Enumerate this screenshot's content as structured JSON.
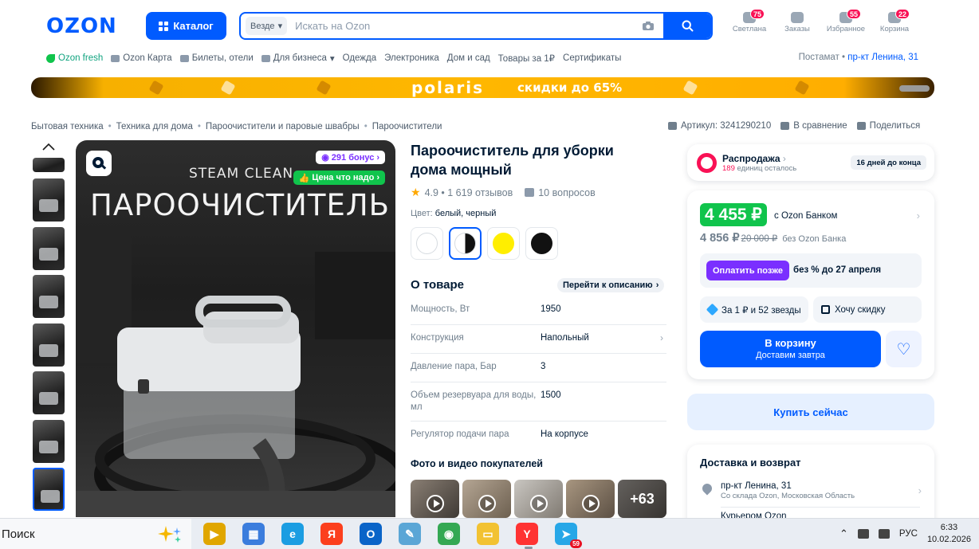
{
  "header": {
    "logo": "OZON",
    "catalog_label": "Каталог",
    "search": {
      "scope": "Везде",
      "placeholder": "Искать на Ozon"
    },
    "icons": [
      {
        "label": "Светлана",
        "badge": "75"
      },
      {
        "label": "Заказы",
        "badge": ""
      },
      {
        "label": "Избранное",
        "badge": "55"
      },
      {
        "label": "Корзина",
        "badge": "22"
      }
    ]
  },
  "nav": {
    "items": [
      "Ozon fresh",
      "Ozon Карта",
      "Билеты, отели",
      "Для бизнеса",
      "Одежда",
      "Электроника",
      "Дом и сад",
      "Товары за 1₽",
      "Сертификаты"
    ],
    "address_label": "Постамат",
    "address_value": "пр-кт Ленина, 31"
  },
  "banner": {
    "brand": "polaris",
    "promo": "скидки до 65%"
  },
  "breadcrumbs": [
    "Бытовая техника",
    "Техника для дома",
    "Пароочистители и паровые швабры",
    "Пароочистители"
  ],
  "meta": {
    "article": "Артикул: 3241290210",
    "compare": "В сравнение",
    "share": "Поделиться"
  },
  "photo": {
    "subtitle": "STEAM CLEAN",
    "headline": "ПАРООЧИСТИТЕЛЬ",
    "bonus": "291 бонус",
    "good_price": "Цена что надо"
  },
  "product": {
    "title": "Пароочиститель для уборки дома мощный",
    "rating": "4.9 • 1 619 отзывов",
    "questions": "10 вопросов",
    "color_label": "Цвет:",
    "color_value": "белый, черный",
    "swatches": [
      "#ffffff",
      "half",
      "#ffee00",
      "#111111"
    ],
    "about_title": "О товаре",
    "goto_desc": "Перейти к описанию",
    "specs": [
      {
        "k": "Мощность, Вт",
        "v": "1950"
      },
      {
        "k": "Конструкция",
        "v": "Напольный"
      },
      {
        "k": "Давление пара, Бар",
        "v": "3"
      },
      {
        "k": "Объем резервуара для воды, мл",
        "v": "1500"
      },
      {
        "k": "Регулятор подачи пара",
        "v": "На корпусе"
      }
    ],
    "buyer_media_title": "Фото и видео покупателей",
    "buyer_media_more": "+63"
  },
  "sale": {
    "title": "Распродажа",
    "left_count": "189",
    "left_label": "единиц осталось",
    "days": "16 дней до конца"
  },
  "price": {
    "main": "4 455 ₽",
    "main_note": "с Ozon Банком",
    "regular": "4 856 ₽",
    "old": "20 000 ₽",
    "regular_note": "без Ozon Банка",
    "paylater_btn": "Оплатить позже",
    "paylater_text": "без % до 27 апреля",
    "chip_stars": "За 1 ₽ и 52 звезды",
    "chip_discount": "Хочу скидку",
    "cart_label": "В корзину",
    "cart_sub": "Доставим завтра"
  },
  "buy_now": "Купить сейчас",
  "delivery": {
    "title": "Доставка и возврат",
    "address": "пр-кт Ленина, 31",
    "source": "Со склада Ozon, Московская Область",
    "courier": "Курьером Ozon"
  },
  "taskbar": {
    "search": "Поиск",
    "apps": [
      {
        "name": "media-player-icon",
        "color": "#e0a600",
        "glyph": "▶"
      },
      {
        "name": "store-icon",
        "color": "#3b7ddd",
        "glyph": "▦"
      },
      {
        "name": "edge-icon",
        "color": "#1b9de2",
        "glyph": "e"
      },
      {
        "name": "yandex-icon",
        "color": "#fc3f1d",
        "glyph": "Я"
      },
      {
        "name": "outlook-icon",
        "color": "#0a64c8",
        "glyph": "O"
      },
      {
        "name": "notepad-icon",
        "color": "#5aa6d6",
        "glyph": "✎"
      },
      {
        "name": "chrome-icon",
        "color": "#34a853",
        "glyph": "◉"
      },
      {
        "name": "explorer-icon",
        "color": "#f2c232",
        "glyph": "▭"
      },
      {
        "name": "yandex-browser-icon",
        "color": "#ff3333",
        "glyph": "Y"
      },
      {
        "name": "telegram-icon",
        "color": "#27a7e7",
        "glyph": "➤"
      }
    ],
    "telegram_badge": "59",
    "lang": "РУС",
    "time": "6:33",
    "date": "10.02.2026"
  }
}
